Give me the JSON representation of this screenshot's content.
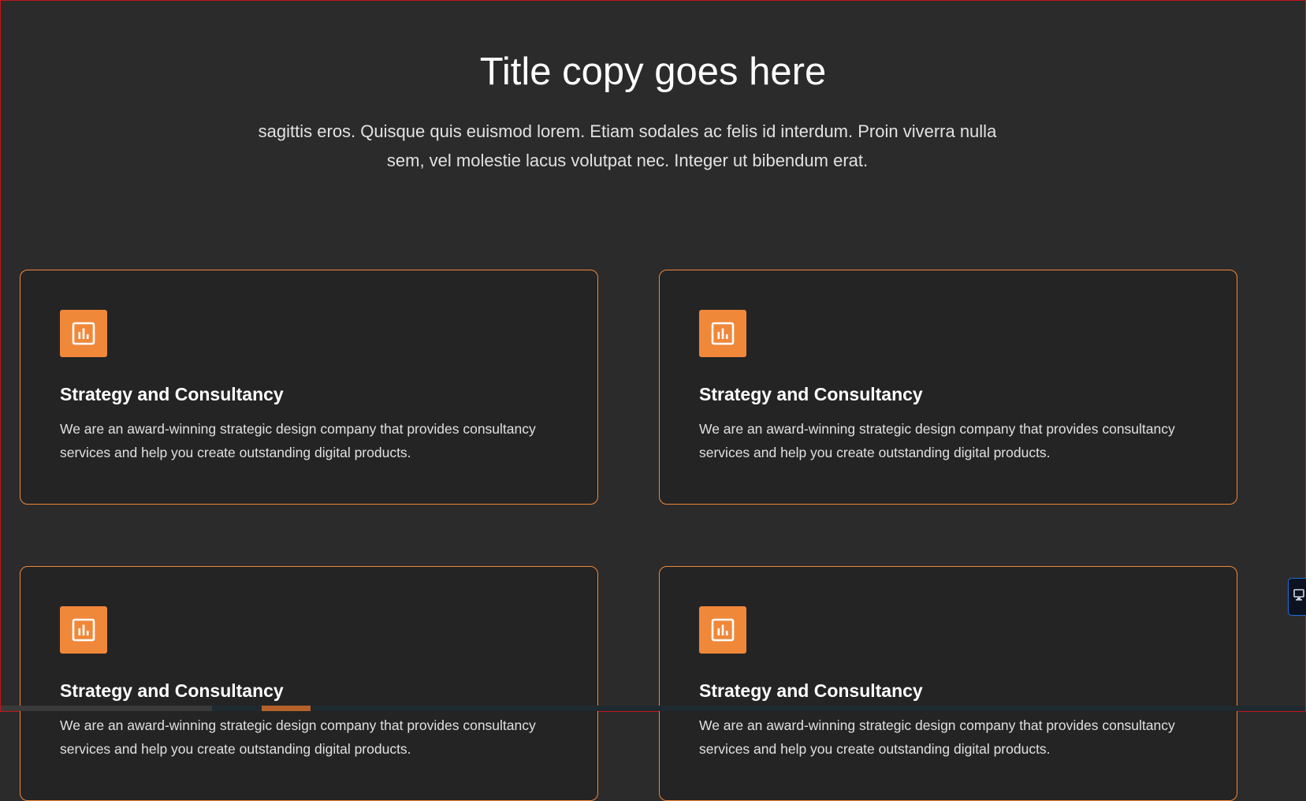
{
  "header": {
    "title": "Title copy goes here",
    "subtitle": "sagittis eros. Quisque quis euismod lorem. Etiam sodales ac felis id interdum. Proin viverra nulla sem, vel molestie lacus volutpat nec. Integer ut bibendum erat."
  },
  "cards": [
    {
      "icon": "bar-chart-icon",
      "title": "Strategy and Consultancy",
      "text": "We are an award-winning strategic design company that provides consultancy services and help you create outstanding digital products."
    },
    {
      "icon": "bar-chart-icon",
      "title": "Strategy and Consultancy",
      "text": "We are an award-winning strategic design company that provides consultancy services and help you create outstanding digital products."
    },
    {
      "icon": "bar-chart-icon",
      "title": "Strategy and Consultancy",
      "text": "We are an award-winning strategic design company that provides consultancy services and help you create outstanding digital products."
    },
    {
      "icon": "bar-chart-icon",
      "title": "Strategy and Consultancy",
      "text": "We are an award-winning strategic design company that provides consultancy services and help you create outstanding digital products."
    }
  ],
  "side_widget": {
    "icon": "monitor-icon"
  },
  "colors": {
    "accent": "#f0883a",
    "background": "#2b2b2b",
    "card_background": "#242424",
    "frame": "#c0161b"
  }
}
